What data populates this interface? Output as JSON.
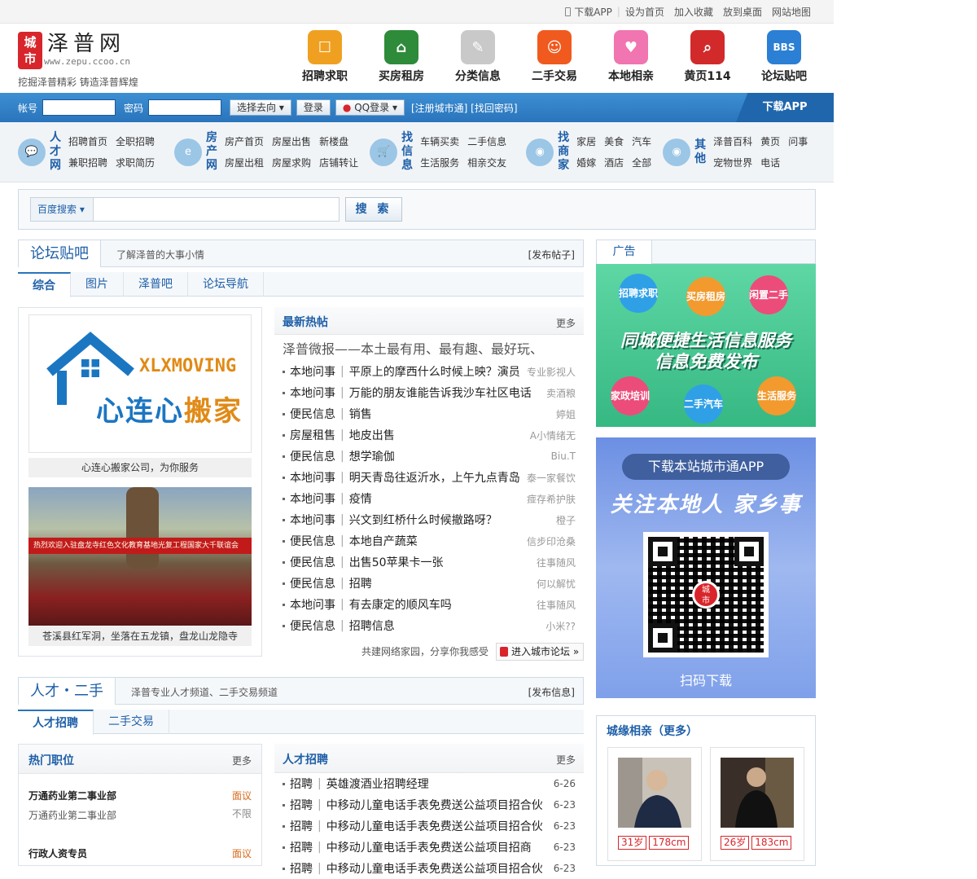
{
  "topbar": {
    "items": [
      "下载APP",
      "设为首页",
      "加入收藏",
      "放到桌面",
      "网站地图"
    ]
  },
  "logo": {
    "mark_line1": "城",
    "mark_line2": "市",
    "name": "泽普网",
    "url": "www.zepu.ccoo.cn",
    "slogan": "挖掘泽普精彩 铸造泽普辉煌"
  },
  "nav": [
    {
      "label": "招聘求职",
      "color": "#f0a020",
      "glyph": "☐"
    },
    {
      "label": "买房租房",
      "color": "#2e8b3a",
      "glyph": "⌂"
    },
    {
      "label": "分类信息",
      "color": "#c9c9c9",
      "glyph": "✎"
    },
    {
      "label": "二手交易",
      "color": "#f05a1f",
      "glyph": "☺"
    },
    {
      "label": "本地相亲",
      "color": "#f075b0",
      "glyph": "♥"
    },
    {
      "label": "黄页114",
      "color": "#d22a2a",
      "glyph": "⌕"
    },
    {
      "label": "论坛贴吧",
      "color": "#2b7fd4",
      "glyph": "BBS"
    }
  ],
  "login": {
    "account_label": "帐号",
    "password_label": "密码",
    "select_label": "选择去向",
    "login_btn": "登录",
    "qq_btn": "QQ登录",
    "links": "[注册城市通] [找回密码]",
    "download": "下载APP"
  },
  "categories": [
    {
      "title": "人才网",
      "links": [
        "招聘首页",
        "全职招聘",
        "",
        "兼职招聘",
        "求职简历",
        ""
      ]
    },
    {
      "title": "房产网",
      "links": [
        "房产首页",
        "房屋出售",
        "新楼盘",
        "房屋出租",
        "房屋求购",
        "店铺转让"
      ]
    },
    {
      "title": "找信息",
      "links": [
        "车辆买卖",
        "二手信息",
        "",
        "生活服务",
        "相亲交友",
        ""
      ]
    },
    {
      "title": "找商家",
      "links": [
        "家居",
        "美食",
        "汽车",
        "婚嫁",
        "酒店",
        "全部"
      ]
    },
    {
      "title": "其他",
      "links": [
        "泽普百科",
        "黄页",
        "问事",
        "宠物世界",
        "电话",
        ""
      ]
    }
  ],
  "search": {
    "engine": "百度搜索",
    "button": "搜 索"
  },
  "forum": {
    "title": "论坛贴吧",
    "subtitle": "了解泽普的大事小情",
    "action": "[发布帖子]",
    "tabs": [
      "综合",
      "图片",
      "泽普吧",
      "论坛导航"
    ],
    "pic1_brand": "XLXMOVING",
    "pic1_cn_a": "心连心",
    "pic1_cn_b": "搬家",
    "pic1_caption": "心连心搬家公司，为你服务",
    "pic2_banner": "热烈欢迎入驻盘龙寺红色文化教育基地光复工程国家大千联谊会",
    "pic2_caption": "苍溪县红军洞，坐落在五龙镇，盘龙山龙隐寺",
    "hot_title": "最新热帖",
    "more": "更多",
    "headline": "泽普微报——本土最有用、最有趣、最好玩、",
    "posts": [
      {
        "cat": "本地问事",
        "title": "平原上的摩西什么时候上映？演员",
        "author": "专业影视人"
      },
      {
        "cat": "本地问事",
        "title": "万能的朋友谁能告诉我沙车社区电话",
        "author": "卖酒粮"
      },
      {
        "cat": "便民信息",
        "title": "销售",
        "author": "婷姐"
      },
      {
        "cat": "房屋租售",
        "title": "地皮出售",
        "author": "A小情绪无"
      },
      {
        "cat": "便民信息",
        "title": "想学瑜伽",
        "author": "Biu.T"
      },
      {
        "cat": "本地问事",
        "title": "明天青岛往返沂水，上午九点青岛",
        "author": "泰一家餐饮"
      },
      {
        "cat": "本地问事",
        "title": "疫情",
        "author": "痖存希护肤"
      },
      {
        "cat": "本地问事",
        "title": "兴文到红桥什么时候撤路呀？",
        "author": "橙子"
      },
      {
        "cat": "便民信息",
        "title": "本地自产蔬菜",
        "author": "信步印沧桑"
      },
      {
        "cat": "便民信息",
        "title": "出售50苹果卡一张",
        "author": "往事随风"
      },
      {
        "cat": "便民信息",
        "title": "招聘",
        "author": "何以解忧"
      },
      {
        "cat": "本地问事",
        "title": "有去康定的顺风车吗",
        "author": "往事随风"
      },
      {
        "cat": "便民信息",
        "title": "招聘信息",
        "author": "小米??"
      }
    ],
    "footer": "共建网络家园，分享你我感受",
    "enter": "进入城市论坛 »"
  },
  "talent": {
    "title": "人才・二手",
    "subtitle": "泽普专业人才频道、二手交易频道",
    "action": "[发布信息]",
    "tabs": [
      "人才招聘",
      "二手交易"
    ],
    "hot_jobs_title": "热门职位",
    "more": "更多",
    "jobs": [
      {
        "name": "万通药业第二事业部",
        "salary": "面议",
        "company": "万通药业第二事业部",
        "pay": "不限"
      },
      {
        "name": "行政人资专员",
        "salary": "面议",
        "company": "",
        "pay": ""
      }
    ],
    "rec_title": "人才招聘",
    "recruits": [
      {
        "cat": "招聘",
        "title": "英雄渡酒业招聘经理",
        "date": "6-26"
      },
      {
        "cat": "招聘",
        "title": "中移动儿童电话手表免费送公益项目招合伙",
        "date": "6-23"
      },
      {
        "cat": "招聘",
        "title": "中移动儿童电话手表免费送公益项目招合伙",
        "date": "6-23"
      },
      {
        "cat": "招聘",
        "title": "中移动儿童电话手表免费送公益项目招商",
        "date": "6-23"
      },
      {
        "cat": "招聘",
        "title": "中移动儿童电话手表免费送公益项目招合伙",
        "date": "6-23"
      }
    ]
  },
  "ads": {
    "title": "广告",
    "ad1_bubbles": [
      "招聘求职",
      "买房租房",
      "闲置二手",
      "家政培训",
      "二手汽车",
      "生活服务"
    ],
    "ad1_line1": "同城便捷生活信息服务",
    "ad1_line2": "信息免费发布",
    "ad2_pill": "下载本站城市通APP",
    "ad2_slogan": "关注本地人 家乡事",
    "ad2_scan": "扫码下载"
  },
  "match": {
    "title": "城缘相亲（更多）",
    "people": [
      {
        "age": "31岁",
        "height": "178cm"
      },
      {
        "age": "26岁",
        "height": "183cm"
      }
    ]
  }
}
